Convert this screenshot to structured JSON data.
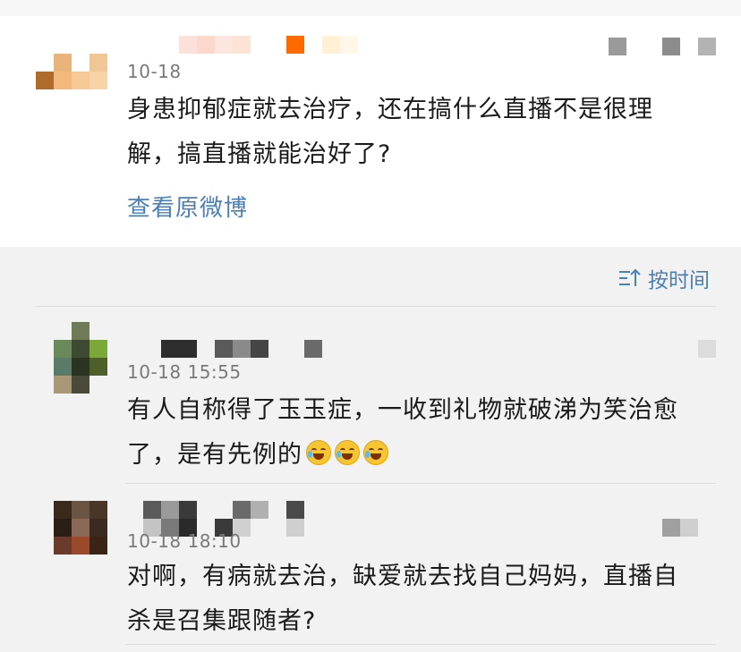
{
  "colors": {
    "background": "#f2f2f2",
    "card": "#ffffff",
    "link": "#4a7fb8",
    "time": "#7a7a7a"
  },
  "top_comment": {
    "time": "10-18",
    "text_line1": "身患抑郁症就去治疗，还在搞什么直播不是很理",
    "text_line2": "解，搞直播就能治好了?",
    "view_original": "查看原微博"
  },
  "sort": {
    "icon": "sort-icon",
    "label": "按时间"
  },
  "replies": [
    {
      "time": "10-18 15:55",
      "text_line1": "有人自称得了玉玉症，一收到礼物就破涕为笑治愈",
      "text_line2": "了，是有先例的",
      "emojis": [
        "laugh-cry-emoji",
        "laugh-cry-emoji",
        "laugh-cry-emoji"
      ]
    },
    {
      "time": "10-18 18:10",
      "text_line1": "对啊，有病就去治，缺爱就去找自己妈妈，直播自",
      "text_line2": "杀是召集跟随者?"
    }
  ]
}
